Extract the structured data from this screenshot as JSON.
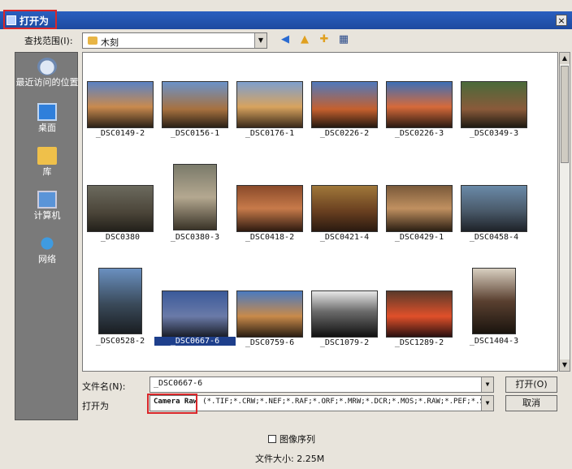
{
  "window": {
    "title": "打开为",
    "close_icon": "×"
  },
  "lookin": {
    "label": "查找范围(I):",
    "value": "木刻"
  },
  "places": [
    {
      "label": "最近访问的位置",
      "icon": "recent-places-icon"
    },
    {
      "label": "桌面",
      "icon": "desktop-icon"
    },
    {
      "label": "库",
      "icon": "library-icon"
    },
    {
      "label": "计算机",
      "icon": "computer-icon"
    },
    {
      "label": "网络",
      "icon": "network-icon"
    }
  ],
  "files": [
    {
      "name": "_DSC0149-2"
    },
    {
      "name": "_DSC0156-1"
    },
    {
      "name": "_DSC0176-1"
    },
    {
      "name": "_DSC0226-2"
    },
    {
      "name": "_DSC0226-3"
    },
    {
      "name": "_DSC0349-3"
    },
    {
      "name": "_DSC0380"
    },
    {
      "name": "_DSC0380-3"
    },
    {
      "name": "_DSC0418-2"
    },
    {
      "name": "_DSC0421-4"
    },
    {
      "name": "_DSC0429-1"
    },
    {
      "name": "_DSC0458-4"
    },
    {
      "name": "_DSC0528-2"
    },
    {
      "name": "_DSC0667-6"
    },
    {
      "name": "_DSC0759-6"
    },
    {
      "name": "_DSC1079-2"
    },
    {
      "name": "_DSC1289-2"
    },
    {
      "name": "_DSC1404-3"
    }
  ],
  "selected_file": "_DSC0667-6",
  "filename": {
    "label": "文件名(N):",
    "value": "_DSC0667-6"
  },
  "filetype": {
    "label": "打开为",
    "format": "Camera Raw",
    "extensions": "(*.TIF;*.CRW;*.NEF;*.RAF;*.ORF;*.MRW;*.DCR;*.MOS;*.RAW;*.PEF;*.SRW"
  },
  "buttons": {
    "open": "打开(O)",
    "cancel": "取消"
  },
  "image_sequence": {
    "label": "图像序列",
    "checked": false
  },
  "file_size": "文件大小: 2.25M",
  "colors": {
    "title_bar": "#1d4aa0",
    "highlight": "#d9262a",
    "selection": "#1e3f8c"
  }
}
